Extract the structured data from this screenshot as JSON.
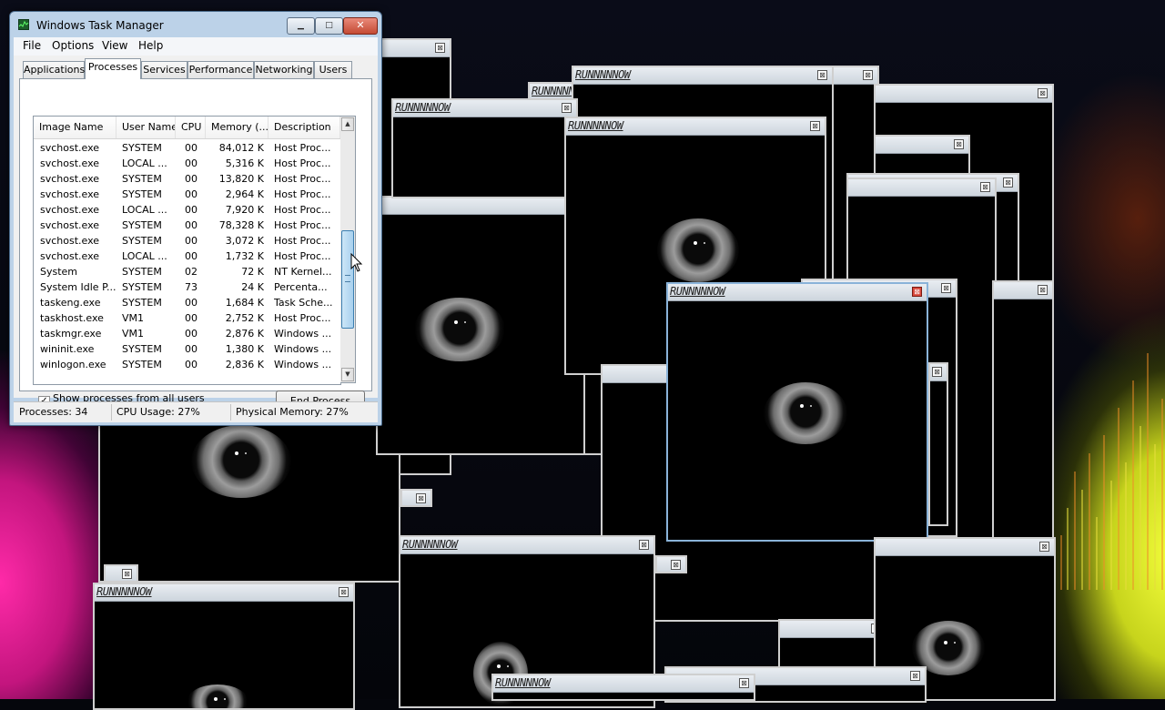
{
  "popup_title": "RUNNNNNOW",
  "popup_close_glyph": "⊠",
  "task_manager": {
    "title": "Windows Task Manager",
    "caption_buttons": {
      "minimize": "▁",
      "maximize": "□",
      "close": "✕"
    },
    "menu": [
      "File",
      "Options",
      "View",
      "Help"
    ],
    "tabs": [
      "Applications",
      "Processes",
      "Services",
      "Performance",
      "Networking",
      "Users"
    ],
    "selected_tab": "Processes",
    "columns": [
      "Image Name",
      "User Name",
      "CPU",
      "Memory (...",
      "Description"
    ],
    "sort_indicator": "^",
    "rows": [
      {
        "name": "svchost.exe",
        "user": "SYSTEM",
        "cpu": "00",
        "mem": "84,012 K",
        "desc": "Host Proc..."
      },
      {
        "name": "svchost.exe",
        "user": "LOCAL ...",
        "cpu": "00",
        "mem": "5,316 K",
        "desc": "Host Proc..."
      },
      {
        "name": "svchost.exe",
        "user": "SYSTEM",
        "cpu": "00",
        "mem": "13,820 K",
        "desc": "Host Proc..."
      },
      {
        "name": "svchost.exe",
        "user": "SYSTEM",
        "cpu": "00",
        "mem": "2,964 K",
        "desc": "Host Proc..."
      },
      {
        "name": "svchost.exe",
        "user": "LOCAL ...",
        "cpu": "00",
        "mem": "7,920 K",
        "desc": "Host Proc..."
      },
      {
        "name": "svchost.exe",
        "user": "SYSTEM",
        "cpu": "00",
        "mem": "78,328 K",
        "desc": "Host Proc..."
      },
      {
        "name": "svchost.exe",
        "user": "SYSTEM",
        "cpu": "00",
        "mem": "3,072 K",
        "desc": "Host Proc..."
      },
      {
        "name": "svchost.exe",
        "user": "LOCAL ...",
        "cpu": "00",
        "mem": "1,732 K",
        "desc": "Host Proc..."
      },
      {
        "name": "System",
        "user": "SYSTEM",
        "cpu": "02",
        "mem": "72 K",
        "desc": "NT Kernel..."
      },
      {
        "name": "System Idle P...",
        "user": "SYSTEM",
        "cpu": "73",
        "mem": "24 K",
        "desc": "Percenta..."
      },
      {
        "name": "taskeng.exe",
        "user": "SYSTEM",
        "cpu": "00",
        "mem": "1,684 K",
        "desc": "Task Sche..."
      },
      {
        "name": "taskhost.exe",
        "user": "VM1",
        "cpu": "00",
        "mem": "2,752 K",
        "desc": "Host Proc..."
      },
      {
        "name": "taskmgr.exe",
        "user": "VM1",
        "cpu": "00",
        "mem": "2,876 K",
        "desc": "Windows ..."
      },
      {
        "name": "wininit.exe",
        "user": "SYSTEM",
        "cpu": "00",
        "mem": "1,380 K",
        "desc": "Windows ..."
      },
      {
        "name": "winlogon.exe",
        "user": "SYSTEM",
        "cpu": "00",
        "mem": "2,836 K",
        "desc": "Windows ..."
      }
    ],
    "scroll": {
      "up": "▲",
      "down": "▼",
      "position_fraction": 0.72
    },
    "show_all_users_label": "Show processes from all users",
    "show_all_users_checked": true,
    "show_all_users_mark": "✓",
    "end_process_label": "End Process",
    "status": {
      "processes": "Processes: 34",
      "cpu_usage": "CPU Usage: 27%",
      "physical_memory": "Physical Memory: 27%"
    }
  },
  "colors": {
    "accent_blue": "#bcd2e8",
    "close_red": "#c44a34",
    "wallpaper_pink": "#ff2aa8",
    "wallpaper_yellow": "#f4ff3c"
  }
}
